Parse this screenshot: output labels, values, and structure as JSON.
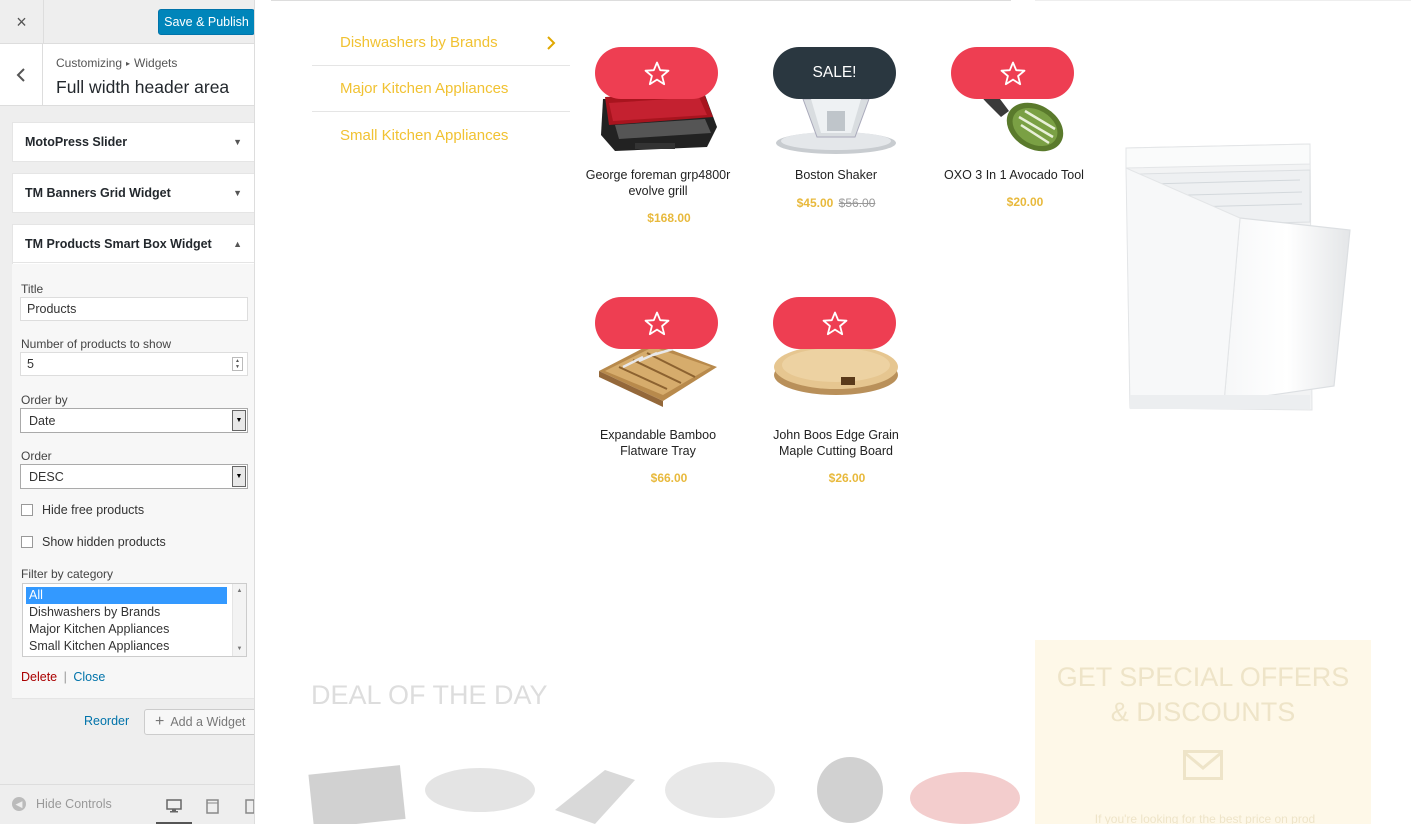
{
  "customizer": {
    "close_icon": "×",
    "save_label": "Save & Publish",
    "back_icon": "‹",
    "breadcrumb": [
      "Customizing",
      "Widgets"
    ],
    "breadcrumb_sep": "▸",
    "section_title": "Full width header area",
    "widgets": [
      {
        "title": "MotoPress Slider",
        "state": "collapsed"
      },
      {
        "title": "TM Banners Grid Widget",
        "state": "collapsed"
      },
      {
        "title": "TM Products Smart Box Widget",
        "state": "expanded"
      }
    ],
    "form": {
      "title_label": "Title",
      "title_value": "Products",
      "count_label": "Number of products to show",
      "count_value": "5",
      "order_by_label": "Order by",
      "order_by_value": "Date",
      "order_label": "Order",
      "order_value": "DESC",
      "hide_free_label": "Hide free products",
      "show_hidden_label": "Show hidden products",
      "filter_label": "Filter by category",
      "categories": [
        "All",
        "Dishwashers by Brands",
        "Major Kitchen Appliances",
        "Small Kitchen Appliances"
      ],
      "selected_category": "All",
      "delete_label": "Delete",
      "close_label": "Close",
      "actions_sep": "|"
    },
    "reorder_label": "Reorder",
    "add_widget_label": "Add a Widget",
    "hide_controls_label": "Hide Controls"
  },
  "preview": {
    "categories": [
      "Dishwashers by Brands",
      "Major Kitchen Appliances",
      "Small Kitchen Appliances"
    ],
    "products": [
      {
        "name": "George foreman grp4800r evolve grill",
        "price": "$168.00",
        "badge": "star"
      },
      {
        "name": "Boston Shaker",
        "price": "$45.00",
        "old_price": "$56.00",
        "badge": "SALE!"
      },
      {
        "name": "OXO 3 In 1 Avocado Tool",
        "price": "$20.00",
        "badge": "star"
      },
      {
        "name": "Expandable Bamboo Flatware Tray",
        "price": "$66.00",
        "badge": "star"
      },
      {
        "name": "John Boos Edge Grain Maple Cutting Board",
        "price": "$26.00",
        "badge": "star"
      }
    ],
    "deal_title": "DEAL OF THE DAY",
    "offers_title_1": "GET SPECIAL OFFERS",
    "offers_title_2": "& DISCOUNTS",
    "offers_text": "If you're looking for the best price on prod"
  },
  "colors": {
    "accent_blue": "#0085ba",
    "badge_red": "#ee3e52",
    "badge_dark": "#2a3740",
    "price_gold": "#e8b93c",
    "category_gold": "#f1c232"
  }
}
